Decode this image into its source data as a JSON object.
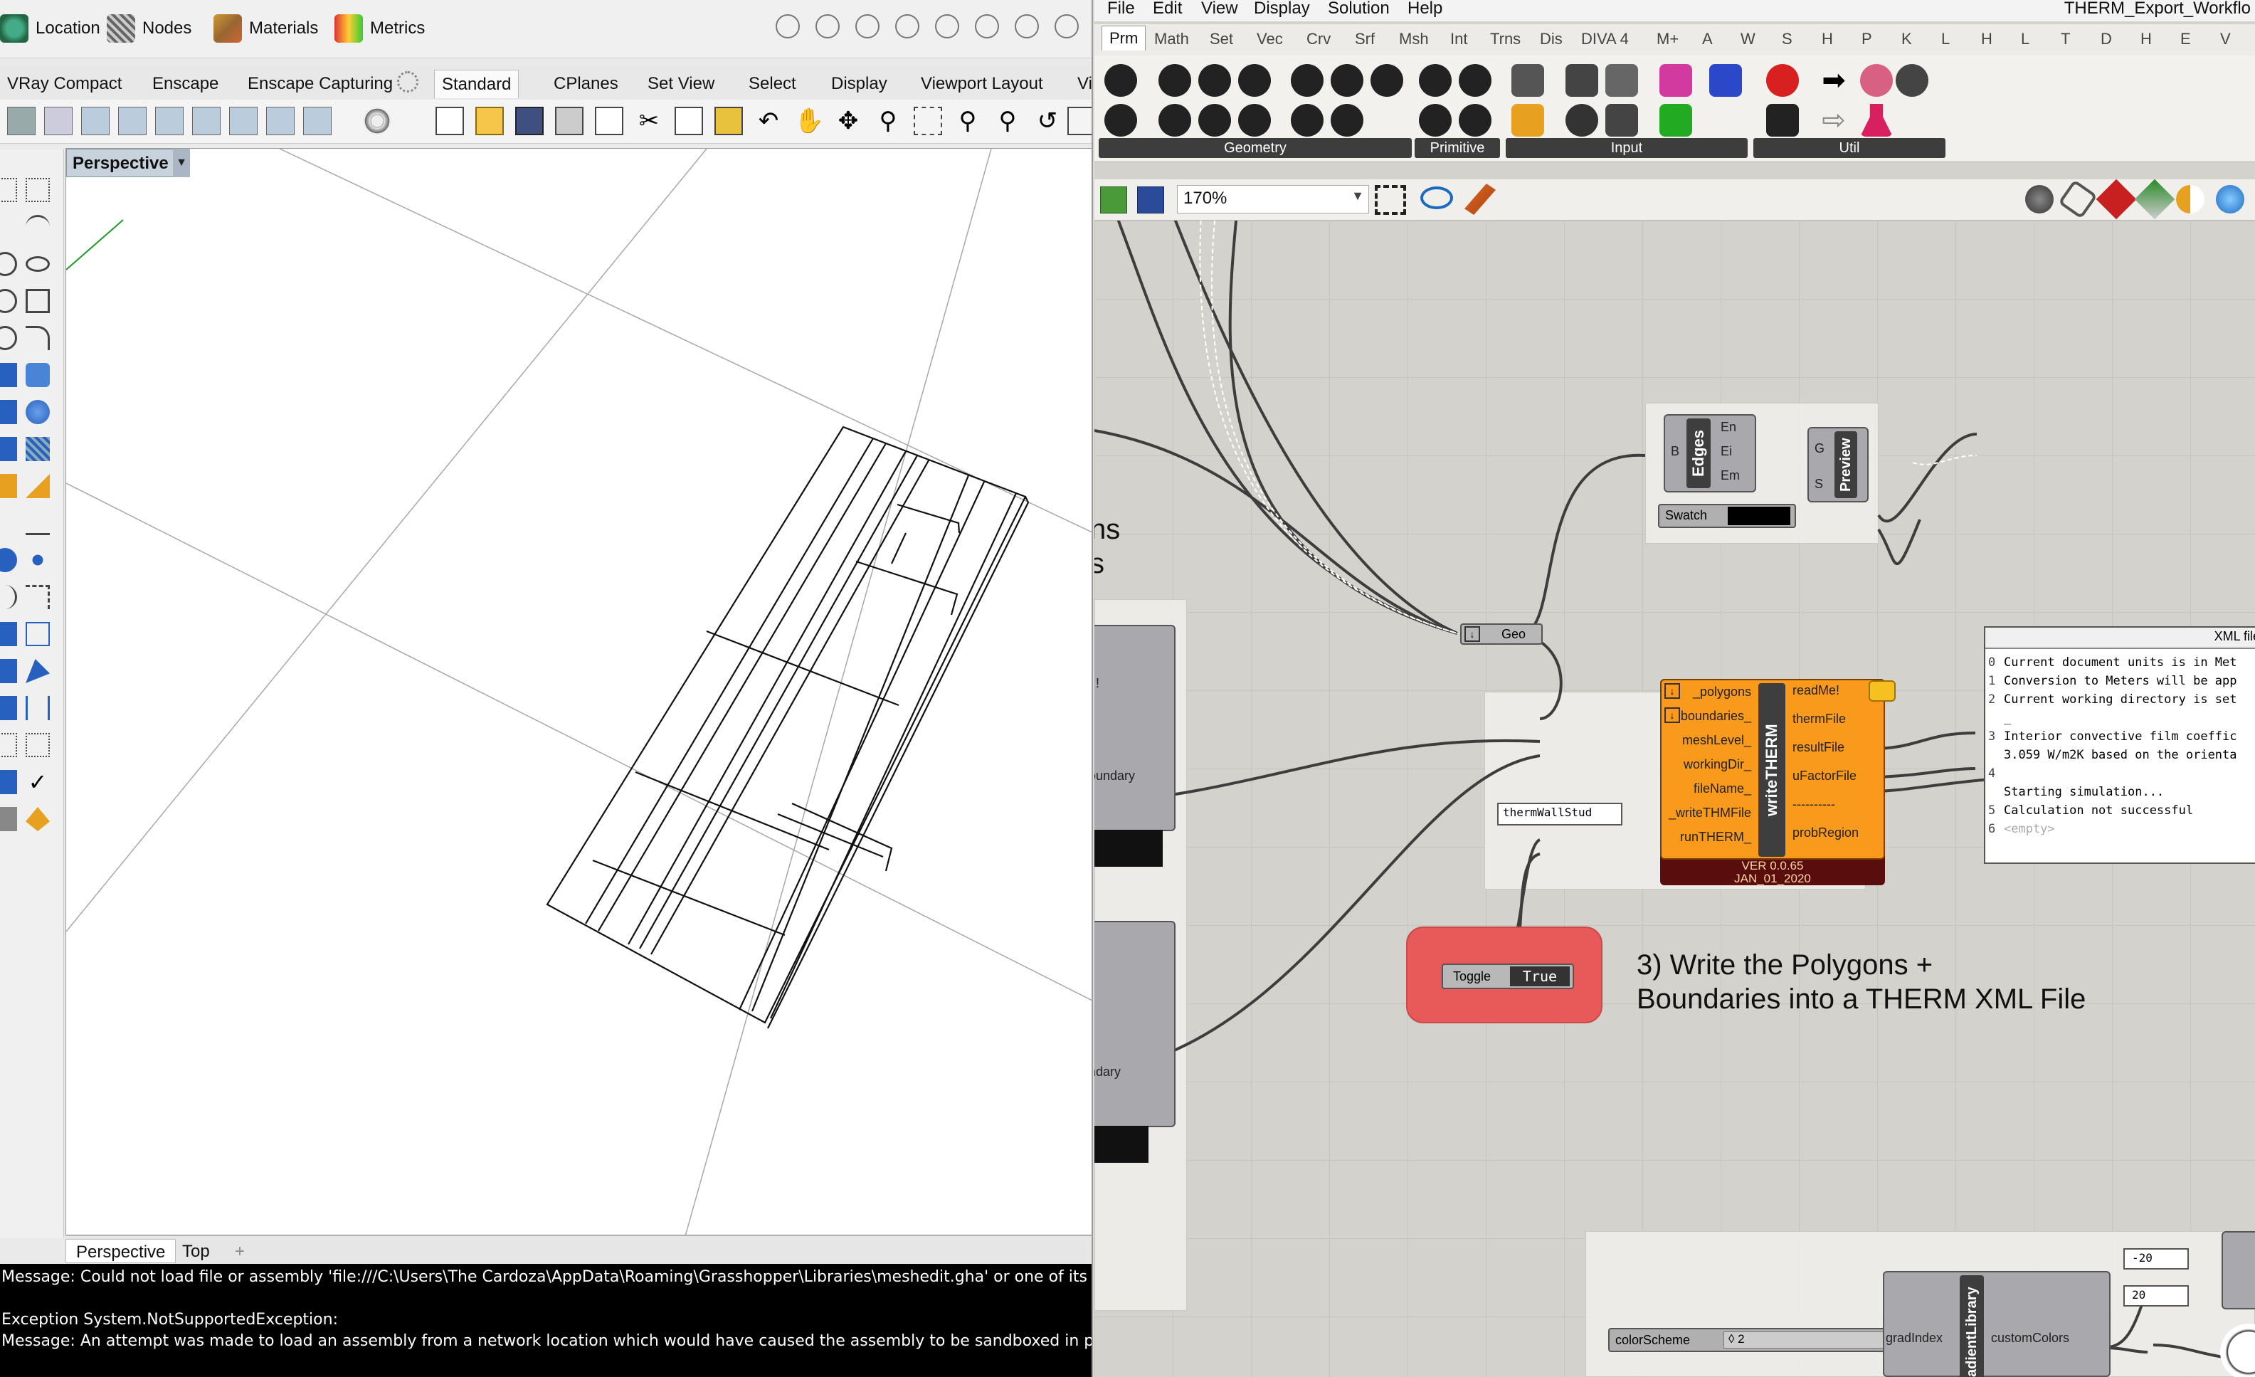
{
  "rhino": {
    "menubar": {
      "location": "Location",
      "nodes": "Nodes",
      "materials": "Materials",
      "metrics": "Metrics"
    },
    "tabs": [
      "VRay Compact",
      "Enscape",
      "Enscape Capturing",
      "Standard",
      "CPlanes",
      "Set View",
      "Select",
      "Display",
      "Viewport Layout",
      "Vi"
    ],
    "active_tab": "Standard",
    "viewport": {
      "title": "Perspective",
      "bottom_tabs": [
        "Perspective",
        "Top"
      ],
      "add_tab": "+"
    },
    "command_history": [
      "Message: Could not load file or assembly 'file:///C:\\Users\\The Cardoza\\AppData\\Roaming\\Grasshopper\\Libraries\\meshedit.gha' or one of its depe",
      "",
      "Exception System.NotSupportedException:",
      "Message: An attempt was made to load an assembly from a network location which would have caused the assembly to be sandboxed in previo"
    ]
  },
  "grasshopper": {
    "menu": [
      "File",
      "Edit",
      "View",
      "Display",
      "Solution",
      "Help"
    ],
    "window_title": "THERM_Export_Workflo",
    "category_tabs": [
      "Prm",
      "Math",
      "Set",
      "Vec",
      "Crv",
      "Srf",
      "Msh",
      "Int",
      "Trns",
      "Dis",
      "DIVA 4",
      "M+",
      "A",
      "W",
      "S",
      "H",
      "P",
      "K",
      "L",
      "H",
      "L",
      "T",
      "D",
      "H",
      "E",
      "V"
    ],
    "active_category": "Prm",
    "ribbon_groups": [
      "Geometry",
      "Primitive",
      "Input",
      "Util"
    ],
    "zoom": "170%",
    "canvas": {
      "edges_component": {
        "name": "Edges",
        "input": "B",
        "outputs": [
          "En",
          "Ei",
          "Em"
        ]
      },
      "preview_component": {
        "name": "Preview",
        "inputs": [
          "G",
          "S"
        ]
      },
      "swatch": "Swatch",
      "geo_param": "Geo",
      "write_therm": {
        "name": "writeTHERM",
        "inputs": [
          "_polygons",
          "boundaries_",
          "meshLevel_",
          "workingDir_",
          "fileName_",
          "_writeTHMFile",
          "runTHERM_"
        ],
        "outputs": [
          "readMe!",
          "thermFile",
          "resultFile",
          "uFactorFile",
          "----------",
          "probRegion"
        ],
        "version": "VER 0.0.65",
        "date": "JAN_01_2020"
      },
      "file_name_panel": "thermWallStud",
      "toggle": {
        "label": "Toggle",
        "value": "True"
      },
      "annotation": [
        "3) Write the Polygons +",
        "Boundaries into a THERM XML File"
      ],
      "partial_text_left": [
        "ns",
        "s"
      ],
      "left_comp_labels": [
        "!",
        "oundary",
        "ndary"
      ],
      "xml_panel": {
        "title": "XML file",
        "lines": [
          {
            "idx": "0",
            "text": "Current document units is in Met"
          },
          {
            "idx": "1",
            "text": "Conversion to Meters will be app"
          },
          {
            "idx": "2",
            "text": "Current working directory is set"
          },
          {
            "idx": "",
            "text": "_"
          },
          {
            "idx": "3",
            "text": "Interior convective film coeffic"
          },
          {
            "idx": "",
            "text": "3.059 W/m2K based on the orienta"
          },
          {
            "idx": "4",
            "text": ""
          },
          {
            "idx": "",
            "text": "Starting simulation..."
          },
          {
            "idx": "5",
            "text": "Calculation not successful"
          },
          {
            "idx": "6",
            "text": "<empty>"
          }
        ]
      },
      "bottom": {
        "color_scheme": "colorScheme",
        "slider_value": "◊ 2",
        "grad_index": "gradIndex",
        "custom_colors": "customColors",
        "gradient_lib": "adientLibrary",
        "value_top": "-20",
        "value_bottom": "20"
      }
    }
  }
}
